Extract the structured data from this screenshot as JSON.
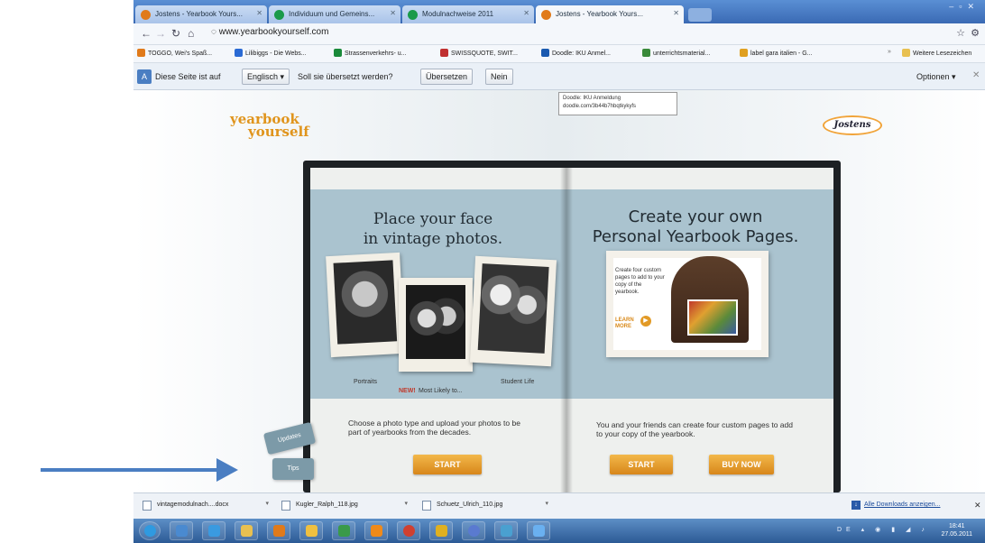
{
  "browser": {
    "tabs": [
      {
        "label": "Jostens - Yearbook Yours...",
        "color": "#e07a1a",
        "active": false
      },
      {
        "label": "Individuum und Gemeins...",
        "color": "#1a9a4a",
        "active": false
      },
      {
        "label": "Modulnachweise 2011",
        "color": "#1a9a4a",
        "active": false
      },
      {
        "label": "Jostens - Yearbook Yours...",
        "color": "#e07a1a",
        "active": true
      }
    ],
    "url": "www.yearbookyourself.com",
    "bookmarks": [
      {
        "label": "TOGGO, Wei's Spaß...",
        "color": "#e07a1a"
      },
      {
        "label": "Lilibiggs - Die Webs...",
        "color": "#2a6ad4"
      },
      {
        "label": "Strassenverkehrs- u...",
        "color": "#1a8a3a"
      },
      {
        "label": "SWISSQUOTE, SWIT...",
        "color": "#c03030"
      },
      {
        "label": "Doodle: IKU Anmel...",
        "color": "#1a5ab0"
      },
      {
        "label": "unterrichtsmaterial...",
        "color": "#3a8a3a"
      },
      {
        "label": "label gara italien - G...",
        "color": "#e0a020"
      }
    ],
    "more_bookmarks": "Weitere Lesezeichen",
    "translate": {
      "prefix": "Diese Seite ist auf",
      "language": "Englisch",
      "question": "Soll sie übersetzt werden?",
      "translate_button": "Übersetzen",
      "no_button": "Nein",
      "options": "Optionen"
    },
    "tooltip": {
      "line1": "Doodle: IKU Anmeldung",
      "line2": "doodle.com/3b44b7hbqtkykyfs"
    }
  },
  "page": {
    "logo_line1": "yearbook",
    "logo_line2": "yourself",
    "brand": "Jostens",
    "left": {
      "heading_line1": "Place your face",
      "heading_line2": "in vintage photos.",
      "photo_captions": {
        "portraits": "Portraits",
        "student_life": "Student Life",
        "new": "NEW!",
        "most_likely": "Most Likely to..."
      },
      "description": "Choose a photo type and upload your photos to be part of yearbooks from the decades.",
      "start_label": "START"
    },
    "right": {
      "heading_line1": "Create your own",
      "heading_line2": "Personal Yearbook Pages.",
      "promo_text": "Create four custom pages to add to your copy of the yearbook.",
      "learn_more": "LEARN MORE",
      "description": "You and your friends can create four custom pages to add to your copy of the yearbook.",
      "start_label": "START",
      "buy_label": "BUY NOW"
    },
    "side_tabs": {
      "updates": "Updates",
      "tips": "Tips"
    }
  },
  "downloads": {
    "items": [
      {
        "label": "vintagemodulnach....docx"
      },
      {
        "label": "Kugler_Ralph_118.jpg"
      },
      {
        "label": "Schuetz_Ulrich_110.jpg"
      }
    ],
    "show_all": "Alle Downloads anzeigen..."
  },
  "taskbar": {
    "icons": [
      {
        "name": "start-orb-icon",
        "color": "#2f9ae0"
      },
      {
        "name": "window-icon",
        "color": "#4a8ad0"
      },
      {
        "name": "ie-icon",
        "color": "#3a9ae0"
      },
      {
        "name": "folder-icon",
        "color": "#e8c050"
      },
      {
        "name": "media-icon",
        "color": "#e07a1a"
      },
      {
        "name": "paint-icon",
        "color": "#f0c040"
      },
      {
        "name": "excel-icon",
        "color": "#3a9a4a"
      },
      {
        "name": "vlc-icon",
        "color": "#f08a1a"
      },
      {
        "name": "chrome-icon",
        "color": "#d04030"
      },
      {
        "name": "app-icon",
        "color": "#e0b020"
      },
      {
        "name": "itunes-icon",
        "color": "#5a7ad0"
      },
      {
        "name": "screen-icon",
        "color": "#4aa0d0"
      },
      {
        "name": "star-icon",
        "color": "#6ab0f0"
      }
    ],
    "language": "DE",
    "time": "18:41",
    "date": "27.05.2011"
  }
}
